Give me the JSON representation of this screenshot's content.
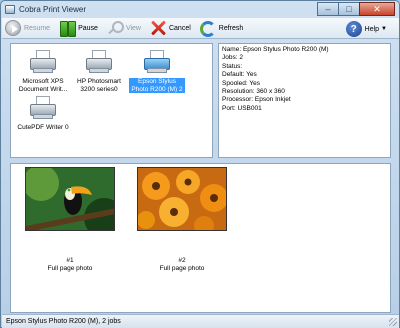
{
  "window": {
    "title": "Cobra Print Viewer",
    "caption_buttons": [
      "–",
      "□",
      "✕"
    ]
  },
  "toolbar": {
    "resume": "Resume",
    "pause": "Pause",
    "view": "View",
    "cancel": "Cancel",
    "refresh": "Refresh",
    "help": "Help"
  },
  "printers": [
    {
      "name": "Microsoft XPS Document Writ...",
      "icon": "printer-icon",
      "selected": false
    },
    {
      "name": "HP Photosmart 3200 series0",
      "icon": "printer-icon",
      "selected": false
    },
    {
      "name": "Epson Stylus Photo R200 (M) 2",
      "icon": "printer-icon",
      "selected": true
    },
    {
      "name": "CutePDF Writer 0",
      "icon": "printer-icon",
      "selected": false
    }
  ],
  "properties": [
    "Name: Epson Stylus Photo R200 (M)",
    "Jobs: 2",
    "Status:",
    "Default: Yes",
    "Spooled: Yes",
    "Resolution: 360 x 360",
    "Processor: Epson Inkjet",
    "Port: USB001"
  ],
  "jobs": [
    {
      "number": "#1",
      "description": "Full page photo",
      "thumbnail": "toucan-photo"
    },
    {
      "number": "#2",
      "description": "Full page photo",
      "thumbnail": "orange-flowers-photo"
    }
  ],
  "status_bar": "Epson Stylus Photo R200 (M),  2 jobs",
  "colors": {
    "selection": "#3399ff",
    "window_frame": "#b7cfe6"
  }
}
